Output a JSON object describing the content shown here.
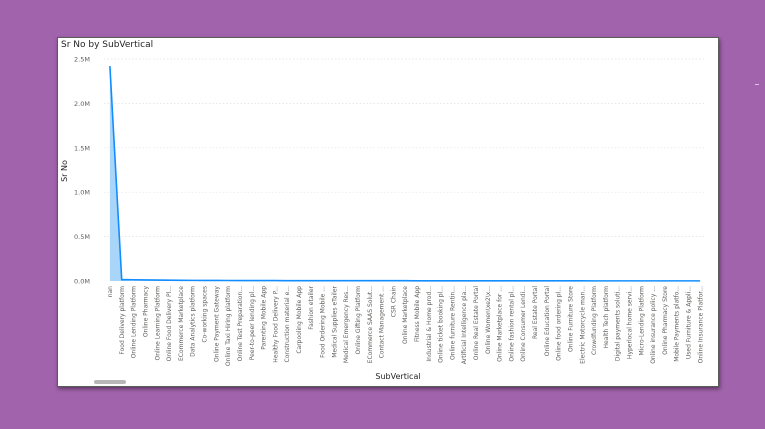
{
  "visual": {
    "title": "Sr No by SubVertical"
  },
  "chart_data": {
    "type": "area",
    "title": "Sr No by SubVertical",
    "xlabel": "SubVertical",
    "ylabel": "Sr No",
    "ylim": [
      0,
      2500000
    ],
    "yticks": [
      "0.0M",
      "0.5M",
      "1.0M",
      "1.5M",
      "2.0M",
      "2.5M"
    ],
    "grid": true,
    "line_color": "#118dff",
    "fill_color": "#9fd0f7",
    "categories": [
      "nan",
      "Food Delivery platform",
      "Online Lending Platform",
      "Online Pharmacy",
      "Online Learning Platform",
      "Online Food Delivery Pl...",
      "ECommerce Marketplace",
      "Data Analytics platform",
      "Co-working spaces",
      "Online Payment Gateway",
      "Online Taxi Hiring platform",
      "Online Test Preparation...",
      "Peer-to-peer lending pl...",
      "Parenting Mobile App",
      "Healthy Food Delivery P...",
      "Construction material e...",
      "Carpooling Mobile App",
      "Fashion etailer",
      "Food Ordering Mobile ...",
      "Medical Supplies eTailer",
      "Medical Emergency Res...",
      "Online Gifting Platform",
      "ECommerce SAAS Solut...",
      "Contact Management ...",
      "CSR Chain",
      "Online Marketplace",
      "Fitness Mobile App",
      "Industrial & Home prod...",
      "Online ticket booking pl...",
      "Online furniture Rentin...",
      "Artificial Intelligence pla...",
      "Online Real Estate Portal",
      "Online Women\\xe2\\x...",
      "Online Marketplace for ...",
      "Online fashion rental pl...",
      "Online Consumer Lendi...",
      "Real Estate Portal",
      "Online Education Portal",
      "Online food ordering pl...",
      "Online Furniture Store",
      "Electric Motorcycle man...",
      "Crowdfunding Platform",
      "Health Tech platform",
      "Digital payments soluti...",
      "Hyperlocal home servi...",
      "Micro-Lending Platform",
      "Online insurance policy ...",
      "Online Pharmacy Store",
      "Mobile Payments platfo...",
      "Used Furniture & Appli...",
      "Online Insurance Platfor..."
    ],
    "values": [
      2420000,
      15000,
      14000,
      12000,
      11000,
      9000,
      8000,
      7000,
      6500,
      6000,
      5500,
      5000,
      5000,
      4500,
      4500,
      4000,
      4000,
      4000,
      3500,
      3500,
      3500,
      3000,
      3000,
      3000,
      3000,
      3000,
      2500,
      2500,
      2500,
      2500,
      2500,
      2500,
      2000,
      2000,
      2000,
      2000,
      2000,
      2000,
      2000,
      2000,
      2000,
      1500,
      1500,
      1500,
      1500,
      1500,
      1500,
      1500,
      1500,
      1500,
      1500
    ]
  }
}
